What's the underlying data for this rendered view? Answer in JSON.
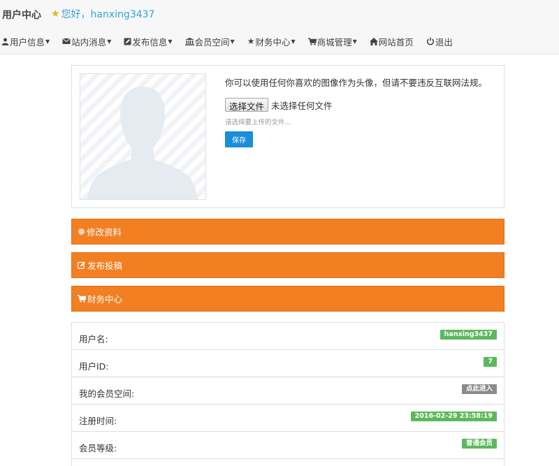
{
  "header": {
    "brand": "用户中心",
    "greeting": "您好，hanxing3437"
  },
  "nav": [
    {
      "icon": "user-icon",
      "label": "用户信息",
      "caret": true
    },
    {
      "icon": "envelope-icon",
      "label": "站内消息",
      "caret": true
    },
    {
      "icon": "edit-icon",
      "label": "发布信息",
      "caret": true
    },
    {
      "icon": "bank-icon",
      "label": "会员空间",
      "caret": true
    },
    {
      "icon": "star-icon",
      "label": "财务中心",
      "caret": true
    },
    {
      "icon": "cart-icon",
      "label": "商城管理",
      "caret": true
    },
    {
      "icon": "home-icon",
      "label": "网站首页",
      "caret": false
    },
    {
      "icon": "power-icon",
      "label": "退出",
      "caret": false
    }
  ],
  "avatar_panel": {
    "description": "你可以使用任何你喜欢的图像作为头像，但请不要违反互联网法规。",
    "file_button": "选择文件",
    "file_status": "未选择任何文件",
    "hint": "请选择要上传的文件...",
    "save_button": "保存"
  },
  "sections": [
    {
      "icon": "gear-icon",
      "label": "修改资料"
    },
    {
      "icon": "edit-icon",
      "label": "发布投稿"
    },
    {
      "icon": "cart-icon",
      "label": "财务中心"
    }
  ],
  "info": [
    {
      "label": "用户名:",
      "value": "hanxing3437",
      "color": "#5cb85c"
    },
    {
      "label": "用户ID:",
      "value": "7",
      "color": "#5cb85c"
    },
    {
      "label": "我的会员空间:",
      "value": "点此进入",
      "color": "#8b8b8b"
    },
    {
      "label": "注册时间:",
      "value": "2016-02-29 23:58:19",
      "color": "#5cb85c"
    },
    {
      "label": "会员等级:",
      "value": "普通会员",
      "color": "#5cb85c"
    }
  ],
  "colors": {
    "accent_orange": "#f27f22",
    "link_blue": "#2fa4d9",
    "button_blue": "#1a8ddb",
    "badge_green": "#5cb85c",
    "badge_gray": "#8b8b8b"
  }
}
